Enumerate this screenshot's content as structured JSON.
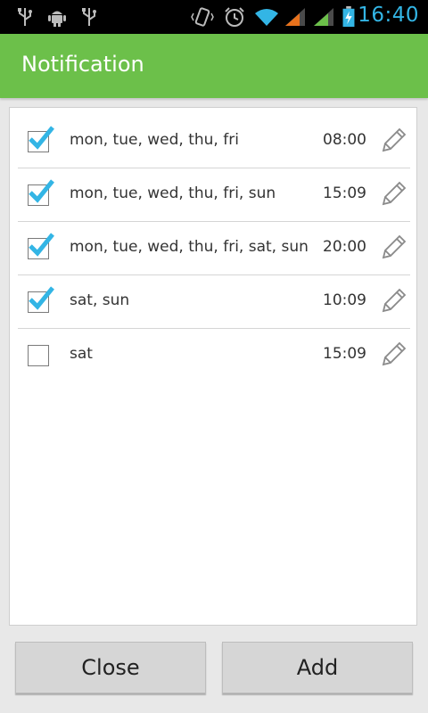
{
  "status_bar": {
    "time": "16:40",
    "icons": [
      "usb-icon",
      "android-debug-icon",
      "usb-icon",
      "vibrate-icon",
      "alarm-icon",
      "wifi-icon",
      "signal-icon",
      "signal-icon",
      "battery-charging-icon"
    ]
  },
  "app_bar": {
    "title": "Notification",
    "color": "#6cc04a"
  },
  "list": {
    "items": [
      {
        "days": "mon, tue, wed, thu, fri",
        "time": "08:00",
        "checked": true
      },
      {
        "days": "mon, tue, wed, thu, fri, sun",
        "time": "15:09",
        "checked": true
      },
      {
        "days": "mon, tue, wed, thu, fri, sat, sun",
        "time": "20:00",
        "checked": true
      },
      {
        "days": "sat, sun",
        "time": "10:09",
        "checked": true
      },
      {
        "days": "sat",
        "time": "15:09",
        "checked": false
      }
    ],
    "edit_icon": "pencil-icon"
  },
  "buttons": {
    "close_label": "Close",
    "add_label": "Add"
  },
  "colors": {
    "checkmark": "#33b5e5",
    "accent_time": "#33b5e5"
  }
}
